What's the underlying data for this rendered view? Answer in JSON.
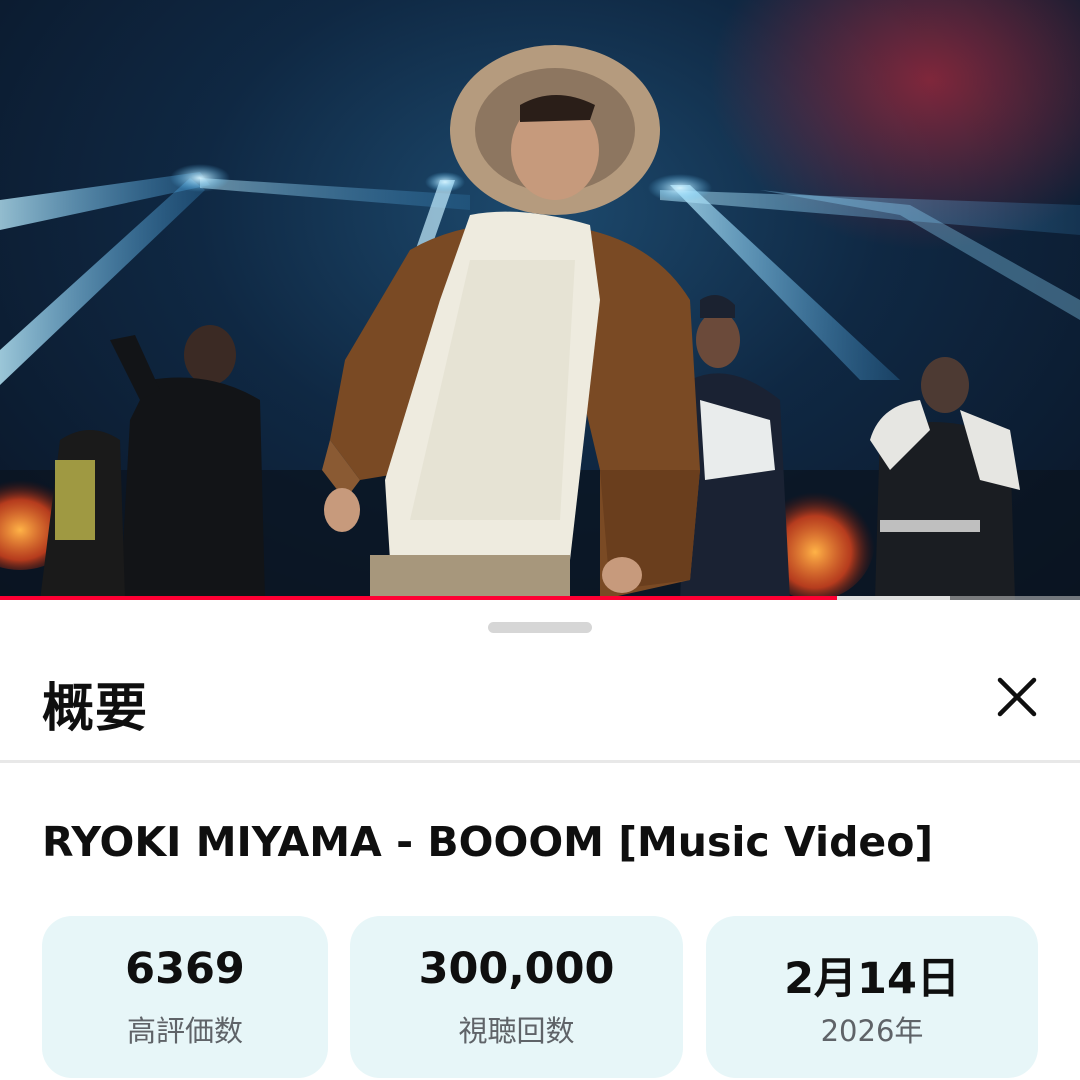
{
  "player": {
    "progress_played_fraction": 0.775,
    "progress_buffered_fraction": 0.88,
    "colors": {
      "played": "#ff0033"
    }
  },
  "sheet": {
    "title": "概要",
    "close_icon": "close-icon",
    "video_title": "RYOKI MIYAMA - BOOOM [Music Video]",
    "stats": {
      "likes": {
        "value": "6369",
        "label": "高評価数"
      },
      "views": {
        "value": "300,000",
        "label": "視聴回数"
      },
      "date": {
        "value": "2月14日",
        "label": "2026年"
      }
    },
    "colors": {
      "stat_bg": "#e7f6f8"
    }
  }
}
